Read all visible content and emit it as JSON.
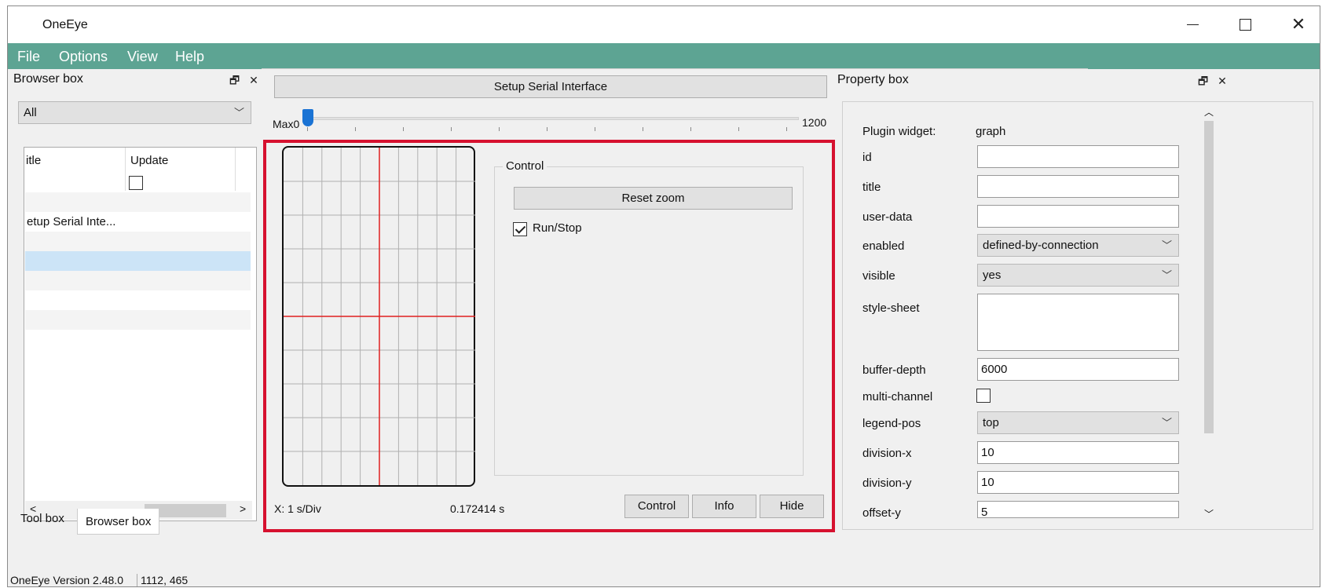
{
  "window": {
    "title": "OneEye",
    "minimize_icon": "minimize-icon",
    "maximize_icon": "maximize-icon",
    "close_icon": "close-icon"
  },
  "menu": {
    "items": [
      "File",
      "Options",
      "View",
      "Help"
    ]
  },
  "browser_box": {
    "title": "Browser box",
    "filter": "All",
    "columns": [
      "itle",
      "Update"
    ],
    "rows": [
      {
        "title": "",
        "update": ""
      },
      {
        "title": "etup Serial Inte...",
        "update": ""
      },
      {
        "title": "",
        "update": ""
      },
      {
        "title": "",
        "update": ""
      },
      {
        "title": "",
        "update": ""
      },
      {
        "title": "",
        "update": ""
      },
      {
        "title": "",
        "update": ""
      }
    ],
    "tabs": [
      "Tool box",
      "Browser box"
    ],
    "active_tab": "Browser box"
  },
  "center": {
    "setup_button": "Setup Serial Interface",
    "slider": {
      "max_label": "Max",
      "min_value": "0",
      "max_value": "1200",
      "position": 0
    },
    "graph": {
      "control_group": "Control",
      "reset_zoom": "Reset zoom",
      "run_stop_label": "Run/Stop",
      "run_stop_checked": true,
      "x_scale": "X: 1 s/Div",
      "time_value": "0.172414 s",
      "buttons": [
        "Control",
        "Info",
        "Hide"
      ],
      "grid_color": "#b0b0b0",
      "crosshair_color": "#e02020"
    }
  },
  "property_box": {
    "title": "Property box",
    "plugin_widget_label": "Plugin widget:",
    "plugin_widget_value": "graph",
    "properties": {
      "id": {
        "label": "id",
        "value": ""
      },
      "title": {
        "label": "title",
        "value": ""
      },
      "user_data": {
        "label": "user-data",
        "value": ""
      },
      "enabled": {
        "label": "enabled",
        "value": "defined-by-connection"
      },
      "visible": {
        "label": "visible",
        "value": "yes"
      },
      "style_sheet": {
        "label": "style-sheet",
        "value": ""
      },
      "buffer_depth": {
        "label": "buffer-depth",
        "value": "6000"
      },
      "multi_channel": {
        "label": "multi-channel",
        "checked": false
      },
      "legend_pos": {
        "label": "legend-pos",
        "value": "top"
      },
      "division_x": {
        "label": "division-x",
        "value": "10"
      },
      "division_y": {
        "label": "division-y",
        "value": "10"
      },
      "offset_y": {
        "label": "offset-y",
        "value": "5"
      }
    }
  },
  "status": {
    "version": "OneEye Version 2.48.0",
    "coords": "1112, 465"
  },
  "colors": {
    "menubar": "#5da493",
    "highlight_frame": "#d6112f",
    "selected_row": "#cce4f7"
  }
}
